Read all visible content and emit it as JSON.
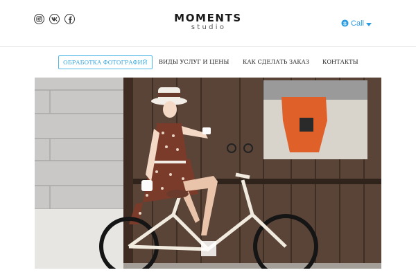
{
  "header": {
    "logo": {
      "title": "MOMENTS",
      "subtitle": "studio"
    },
    "social": [
      {
        "name": "instagram",
        "icon": "instagram-icon"
      },
      {
        "name": "vk",
        "icon": "vk-icon"
      },
      {
        "name": "facebook",
        "icon": "facebook-icon"
      }
    ],
    "call": {
      "label": "Call",
      "icon": "skype-icon",
      "dropdown_icon": "caret-down-icon",
      "accent": "#2a9be0"
    }
  },
  "nav": {
    "items": [
      {
        "label": "ОБРАБОТКА ФОТОГРАФИЙ",
        "active": true
      },
      {
        "label": "ВИДЫ УСЛУГ И ЦЕНЫ",
        "active": false
      },
      {
        "label": "КАК СДЕЛАТЬ ЗАКАЗ",
        "active": false
      },
      {
        "label": "КОНТАКТЫ",
        "active": false
      }
    ],
    "active_color": "#4fb7e6"
  },
  "hero": {
    "image": "woman-on-vintage-bicycle-photo"
  }
}
